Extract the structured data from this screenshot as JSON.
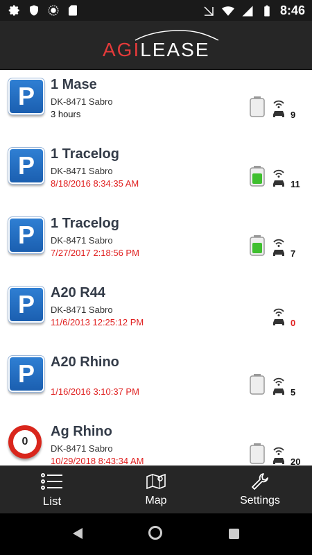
{
  "status_bar": {
    "time": "8:46",
    "left_icons": [
      "gear-icon",
      "shield-icon",
      "sync-icon",
      "sd-card-icon"
    ],
    "right_icons": [
      "signal-icon",
      "wifi-icon",
      "cell-signal-icon",
      "battery-icon"
    ]
  },
  "header": {
    "logo_part1": "AGI",
    "logo_part2": "LEASE"
  },
  "rows": [
    {
      "title": "1 Mase",
      "plate": "DK-8471 Sabro",
      "time": "3 hours",
      "time_color": "black",
      "sign": "parking",
      "sign_text": "P",
      "battery": "empty",
      "count": "9",
      "count_color": "black"
    },
    {
      "title": "1 Tracelog",
      "plate": "DK-8471 Sabro",
      "time": "8/18/2016 8:34:35 AM",
      "time_color": "red",
      "sign": "parking",
      "sign_text": "P",
      "battery": "full",
      "count": "11",
      "count_color": "black"
    },
    {
      "title": "1 Tracelog",
      "plate": "DK-8471 Sabro",
      "time": "7/27/2017 2:18:56 PM",
      "time_color": "red",
      "sign": "parking",
      "sign_text": "P",
      "battery": "full",
      "count": "7",
      "count_color": "black"
    },
    {
      "title": "A20 R44",
      "plate": "DK-8471 Sabro",
      "time": "11/6/2013 12:25:12 PM",
      "time_color": "red",
      "sign": "parking",
      "sign_text": "P",
      "battery": "none",
      "count": "0",
      "count_color": "red"
    },
    {
      "title": "A20 Rhino",
      "plate": "",
      "time": "1/16/2016 3:10:37 PM",
      "time_color": "red",
      "sign": "parking",
      "sign_text": "P",
      "battery": "empty",
      "count": "5",
      "count_color": "black"
    },
    {
      "title": "Ag Rhino",
      "plate": "DK-8471 Sabro",
      "time": "10/29/2018 8:43:34 AM",
      "time_color": "red",
      "sign": "speed",
      "sign_text": "0",
      "battery": "empty",
      "count": "20",
      "count_color": "black"
    }
  ],
  "tabs": [
    {
      "label": "List",
      "icon": "list-icon",
      "active": true
    },
    {
      "label": "Map",
      "icon": "map-icon",
      "active": false
    },
    {
      "label": "Settings",
      "icon": "wrench-icon",
      "active": false
    }
  ],
  "colors": {
    "accent_red": "#e02020",
    "header_bg": "#262626",
    "parking_blue": "#1b5fb0"
  }
}
